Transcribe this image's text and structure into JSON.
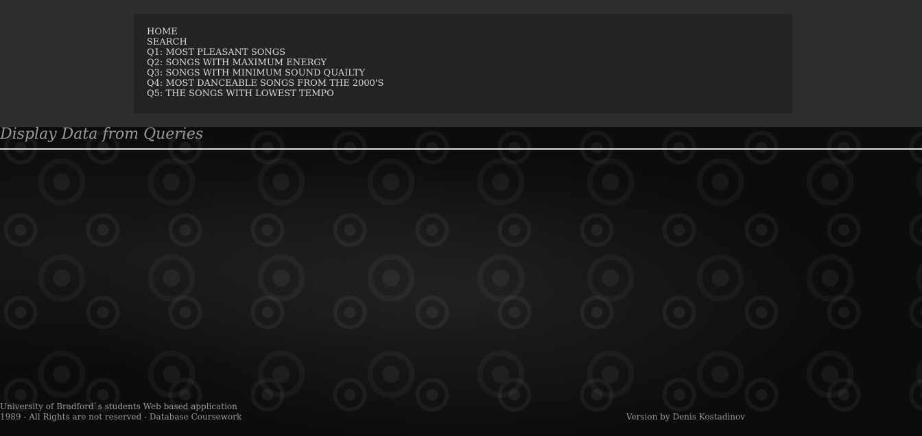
{
  "nav": {
    "items": [
      {
        "label": "HOME"
      },
      {
        "label": "SEARCH"
      },
      {
        "label": "Q1: MOST PLEASANT SONGS"
      },
      {
        "label": "Q2: SONGS WITH MAXIMUM ENERGY"
      },
      {
        "label": "Q3: SONGS WITH MINIMUM SOUND QUAILTY"
      },
      {
        "label": "Q4: MOST DANCEABLE SONGS FROM THE 2000'S"
      },
      {
        "label": "Q5: THE SONGS WITH LOWEST TEMPO"
      }
    ]
  },
  "main": {
    "title": "Display Data from Queries"
  },
  "footer": {
    "line1": "University of Bradford`s students Web based application",
    "line2": "1989 - All Rights are not reserved - Database Coursework",
    "version": "Version by Denis Kostadinov"
  },
  "colors": {
    "topbar": "#2e2e2e",
    "nav_panel": "#232323",
    "nav_text": "#d8d8d8",
    "muted_text": "#9a9a9a",
    "rule": "#e0e0e0"
  }
}
